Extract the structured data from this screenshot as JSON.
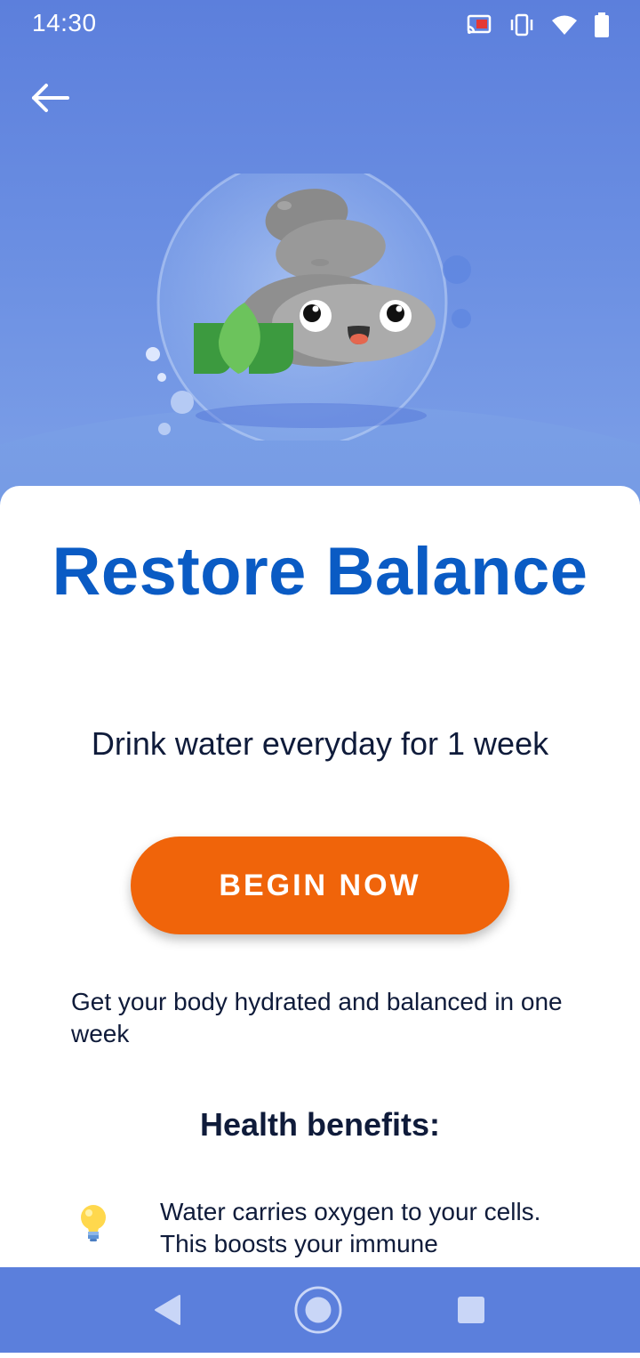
{
  "status_bar": {
    "time": "14:30",
    "icons": [
      "cast-icon",
      "vibrate-icon",
      "wifi-icon",
      "battery-icon"
    ]
  },
  "header": {
    "back_icon": "arrow-left-icon"
  },
  "hero": {
    "illustration": "stacked-stones-character-in-bubble",
    "colors": {
      "background": "#5c7fdc",
      "ground": "#7a9fe6"
    }
  },
  "content": {
    "title": "Restore Balance",
    "subtitle": "Drink water everyday for 1 week",
    "cta_label": "BEGIN NOW",
    "description": "Get your body hydrated and balanced in one week",
    "benefits_heading": "Health benefits:",
    "benefits": [
      {
        "icon": "light-bulb-icon",
        "text": "Water carries oxygen to your cells. This boosts your immune"
      }
    ]
  },
  "colors": {
    "title": "#0a5bc4",
    "cta": "#f0640a",
    "text": "#0f1b3a",
    "nav_bar": "#5b7fdc"
  },
  "nav_bar": {
    "items": [
      "back-triangle-icon",
      "home-circle-icon",
      "recents-square-icon"
    ]
  }
}
